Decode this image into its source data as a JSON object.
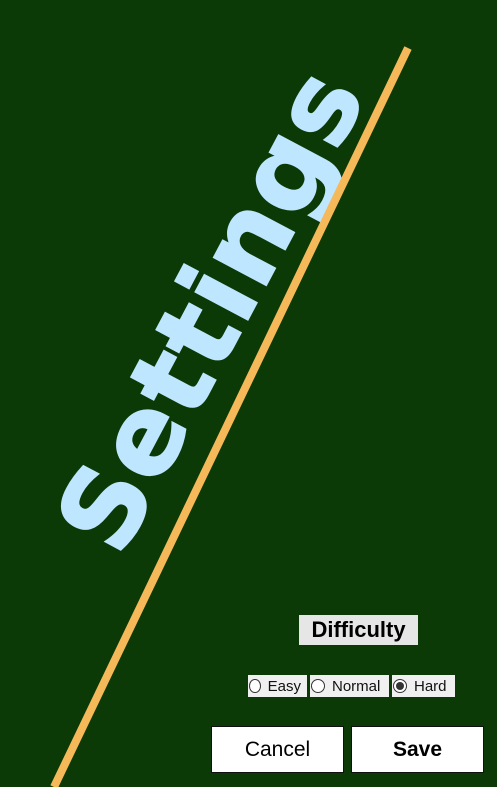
{
  "title": "Settings",
  "difficulty": {
    "label": "Difficulty",
    "options": [
      {
        "label": "Easy",
        "checked": false
      },
      {
        "label": "Normal",
        "checked": false
      },
      {
        "label": "Hard",
        "checked": true
      }
    ]
  },
  "buttons": {
    "cancel_label": "Cancel",
    "save_label": "Save"
  },
  "colors": {
    "background": "#0b3a06",
    "title": "#bfe6ff",
    "accent_line": "#f5b95a"
  }
}
